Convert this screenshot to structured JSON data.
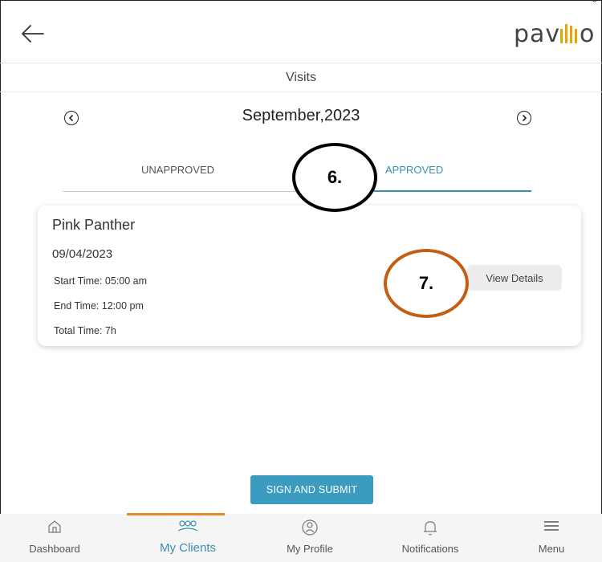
{
  "page_label": "g",
  "header": {
    "brand": "pavillio"
  },
  "title": "Visits",
  "month": "September,2023",
  "tabs": [
    {
      "label": "UNAPPROVED"
    },
    {
      "label": "APPROVED"
    }
  ],
  "annotations": {
    "a6": "6.",
    "a7": "7."
  },
  "card": {
    "client": "Pink Panther",
    "date": "09/04/2023",
    "start": "Start Time: 05:00 am",
    "end": "End Time: 12:00 pm",
    "total": "Total Time: 7h",
    "button": "View Details"
  },
  "sign_button": "SIGN AND SUBMIT",
  "bottom_nav": [
    {
      "label": "Dashboard",
      "icon": "home-icon"
    },
    {
      "label": "My Clients",
      "icon": "clients-icon"
    },
    {
      "label": "My Profile",
      "icon": "profile-icon"
    },
    {
      "label": "Notifications",
      "icon": "bell-icon"
    },
    {
      "label": "Menu",
      "icon": "hamburger-icon"
    }
  ],
  "colors": {
    "accent": "#3b8fb0",
    "active_nav": "#e58a2a",
    "button": "#3b9cc0",
    "annot_7": "#c45e12"
  }
}
